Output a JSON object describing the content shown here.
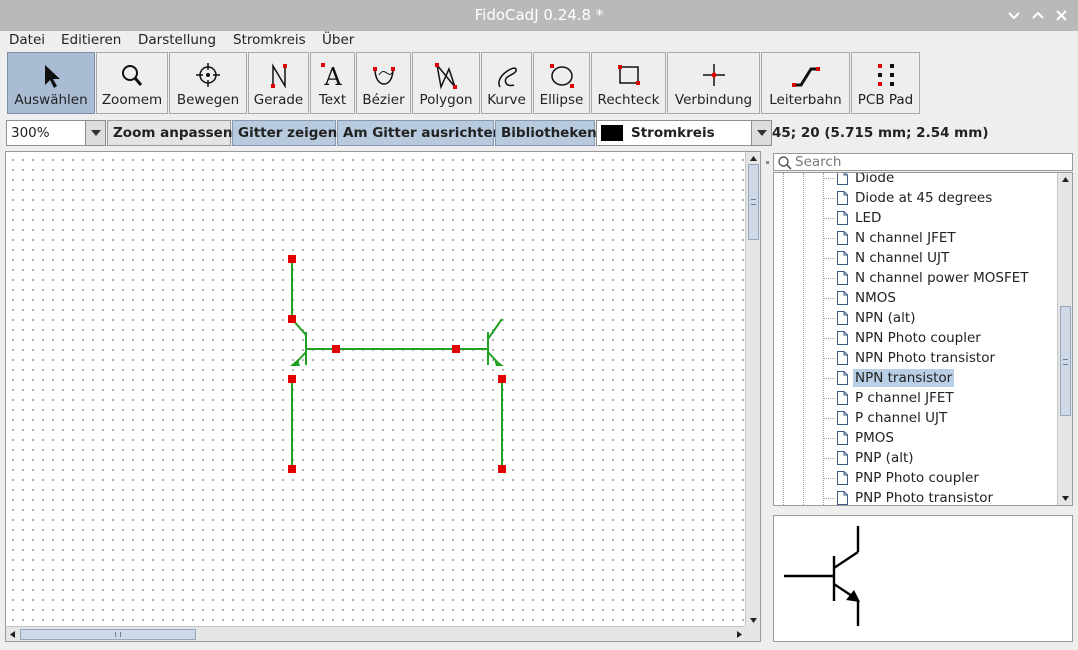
{
  "window": {
    "title": "FidoCadJ 0.24.8  *",
    "minimize_glyph": "⌄",
    "maximize_glyph": "⌃",
    "close_glyph": "✕"
  },
  "menu": [
    "Datei",
    "Editieren",
    "Darstellung",
    "Stromkreis",
    "Über"
  ],
  "toolbar": {
    "tools": [
      {
        "label": "Auswählen",
        "icon": "select-arrow-icon",
        "active": true
      },
      {
        "label": "Zoomem",
        "icon": "zoom-icon"
      },
      {
        "label": "Bewegen",
        "icon": "move-icon"
      },
      {
        "label": "Gerade",
        "icon": "line-icon"
      },
      {
        "label": "Text",
        "icon": "text-icon"
      },
      {
        "label": "Bézier",
        "icon": "bezier-icon"
      },
      {
        "label": "Polygon",
        "icon": "polygon-icon"
      },
      {
        "label": "Kurve",
        "icon": "curve-icon"
      },
      {
        "label": "Ellipse",
        "icon": "ellipse-icon"
      },
      {
        "label": "Rechteck",
        "icon": "rectangle-icon"
      },
      {
        "label": "Verbindung",
        "icon": "connection-icon"
      },
      {
        "label": "Leiterbahn",
        "icon": "pcb-track-icon"
      },
      {
        "label": "PCB Pad",
        "icon": "pcb-pad-icon"
      }
    ]
  },
  "bar2": {
    "zoom_value": "300%",
    "zoom_fit": "Zoom anpassen",
    "show_grid": "Gitter zeigen",
    "snap_grid": "Am Gitter ausrichten",
    "libraries": "Bibliotheken",
    "layer_name": "Stromkreis",
    "layer_color": "#000000",
    "coords": "45; 20 (5.715 mm; 2.54 mm)"
  },
  "library": {
    "search_placeholder": "Search",
    "items": [
      "Diode",
      "Diode at 45 degrees",
      "LED",
      "N channel JFET",
      "N channel UJT",
      "N channel power MOSFET",
      "NMOS",
      "NPN (alt)",
      "NPN Photo coupler",
      "NPN Photo transistor",
      "NPN transistor",
      "P channel JFET",
      "P channel UJT",
      "PMOS",
      "PNP (alt)",
      "PNP Photo coupler",
      "PNP Photo transistor"
    ],
    "selected": "NPN transistor"
  },
  "colors": {
    "circuit": "#22a022",
    "handle": "#e00000",
    "selection": "#b8cfe5"
  }
}
